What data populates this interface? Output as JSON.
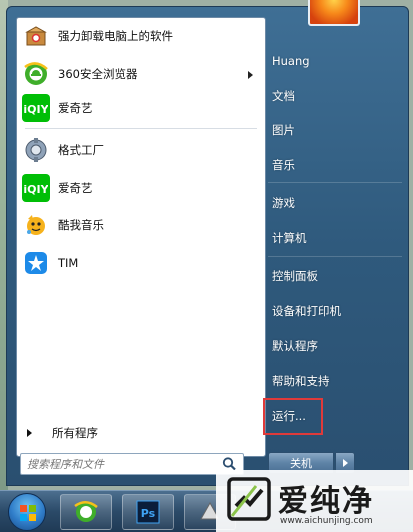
{
  "programs": [
    {
      "label": "强力卸载电脑上的软件",
      "icon": "uninstall-box-icon",
      "has_submenu": false
    },
    {
      "label": "360安全浏览器",
      "icon": "360-browser-icon",
      "has_submenu": true
    },
    {
      "label": "爱奇艺",
      "icon": "iqiyi-icon",
      "has_submenu": false
    },
    {
      "label": "格式工厂",
      "icon": "format-factory-icon",
      "has_submenu": false
    },
    {
      "label": "爱奇艺",
      "icon": "iqiyi-icon",
      "has_submenu": false
    },
    {
      "label": "酷我音乐",
      "icon": "kuwo-music-icon",
      "has_submenu": false
    },
    {
      "label": "TIM",
      "icon": "tim-icon",
      "has_submenu": false
    }
  ],
  "all_programs": "所有程序",
  "search": {
    "placeholder": "搜索程序和文件"
  },
  "right_menu": [
    "Huang",
    "文档",
    "图片",
    "音乐",
    "游戏",
    "计算机",
    "控制面板",
    "设备和打印机",
    "默认程序",
    "帮助和支持",
    "运行..."
  ],
  "shutdown_label": "关机",
  "watermark": {
    "text": "爱纯净",
    "url": "www.aichunjing.com"
  },
  "colors": {
    "iqiyi_green": "#00be06",
    "run_highlight": "#e03a3a",
    "menu_blue": "#2f5a7d"
  }
}
